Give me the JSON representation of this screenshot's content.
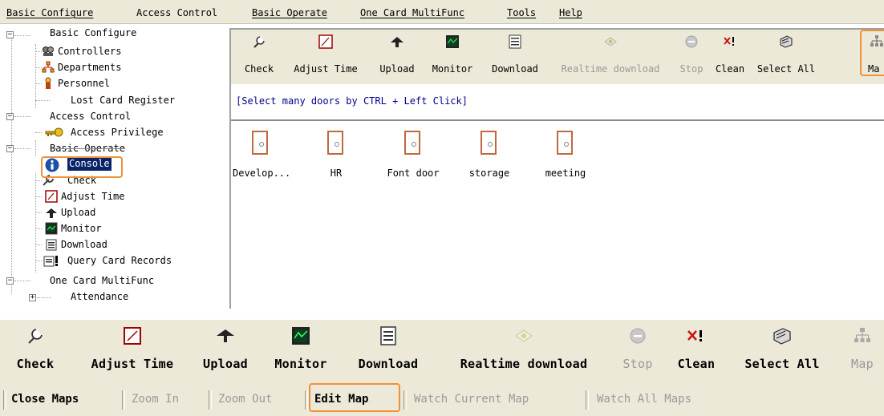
{
  "menu": {
    "items": [
      "Basic Configure",
      "Access Control",
      "Basic Operate",
      "One Card MultiFunc",
      "Tools",
      "Help"
    ]
  },
  "tree": {
    "basic_configure": "Basic Configure",
    "controllers": "Controllers",
    "departments": "Departments",
    "personnel": "Personnel",
    "lost_card": "Lost Card Register",
    "access_control": "Access Control",
    "access_privilege": "Access Privilege",
    "basic_operate": "Basic Operate",
    "console": "Console",
    "check": "Check",
    "adjust_time": "Adjust Time",
    "upload": "Upload",
    "monitor": "Monitor",
    "download": "Download",
    "query_card_records": "Query Card Records",
    "one_card": "One Card MultiFunc",
    "attendance": "Attendance"
  },
  "toolbar": {
    "check": "Check",
    "adjust_time": "Adjust Time",
    "upload": "Upload",
    "monitor": "Monitor",
    "download": "Download",
    "realtime_download": "Realtime download",
    "stop": "Stop",
    "clean": "Clean",
    "select_all": "Select All",
    "map": "Map",
    "map_truncated": "Ma"
  },
  "hint": "[Select many doors by CTRL + Left Click]",
  "doors": [
    "Develop...",
    "HR",
    "Font door",
    "storage",
    "meeting"
  ],
  "map_toolbar": {
    "close_maps": "Close Maps",
    "zoom_in": "Zoom In",
    "zoom_out": "Zoom Out",
    "edit_map": "Edit Map",
    "watch_current_map": "Watch Current Map",
    "watch_all_maps": "Watch All Maps"
  },
  "colors": {
    "highlight": "#f0913a",
    "selection": "#0a246a",
    "door": "#c0693e",
    "hint": "#00008b"
  }
}
